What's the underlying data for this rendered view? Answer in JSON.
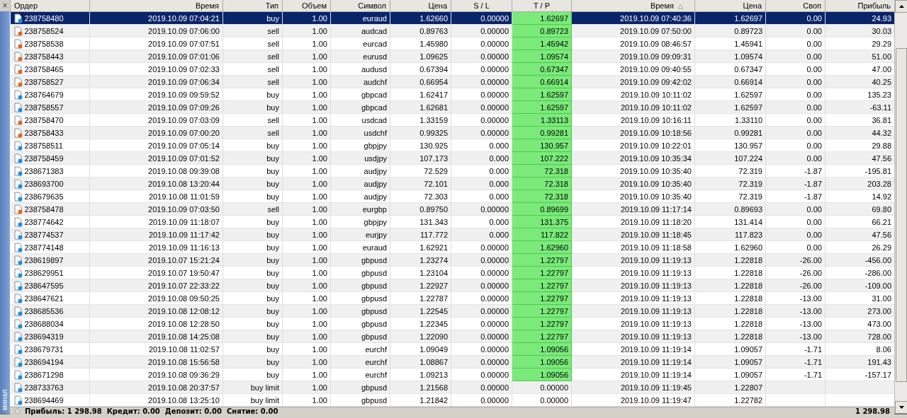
{
  "panel": {
    "close_label": "×",
    "side_label": "минал"
  },
  "table": {
    "columns": [
      {
        "label": "Ордер"
      },
      {
        "label": "Время"
      },
      {
        "label": "Тип"
      },
      {
        "label": "Объем"
      },
      {
        "label": "Символ"
      },
      {
        "label": "Цена"
      },
      {
        "label": "S / L"
      },
      {
        "label": "T / P"
      },
      {
        "label": "Время",
        "sorted": true
      },
      {
        "label": "Цена"
      },
      {
        "label": "Своп"
      },
      {
        "label": "Прибыль"
      }
    ],
    "rows": [
      {
        "kind": "buy",
        "selected": true,
        "tp_hit": true,
        "cells": [
          "238758480",
          "2019.10.09 07:04:21",
          "buy",
          "1.00",
          "euraud",
          "1.62660",
          "0.00000",
          "1.62697",
          "2019.10.09 07:40:36",
          "1.62697",
          "0.00",
          "24.93"
        ]
      },
      {
        "kind": "sell",
        "selected": false,
        "tp_hit": true,
        "cells": [
          "238758524",
          "2019.10.09 07:06:00",
          "sell",
          "1.00",
          "audcad",
          "0.89763",
          "0.00000",
          "0.89723",
          "2019.10.09 07:50:00",
          "0.89723",
          "0.00",
          "30.03"
        ]
      },
      {
        "kind": "sell",
        "selected": false,
        "tp_hit": true,
        "cells": [
          "238758538",
          "2019.10.09 07:07:51",
          "sell",
          "1.00",
          "eurcad",
          "1.45980",
          "0.00000",
          "1.45942",
          "2019.10.09 08:46:57",
          "1.45941",
          "0.00",
          "29.29"
        ]
      },
      {
        "kind": "sell",
        "selected": false,
        "tp_hit": true,
        "cells": [
          "238758443",
          "2019.10.09 07:01:06",
          "sell",
          "1.00",
          "eurusd",
          "1.09625",
          "0.00000",
          "1.09574",
          "2019.10.09 09:09:31",
          "1.09574",
          "0.00",
          "51.00"
        ]
      },
      {
        "kind": "sell",
        "selected": false,
        "tp_hit": true,
        "cells": [
          "238758465",
          "2019.10.09 07:02:33",
          "sell",
          "1.00",
          "audusd",
          "0.67394",
          "0.00000",
          "0.67347",
          "2019.10.09 09:40:55",
          "0.67347",
          "0.00",
          "47.00"
        ]
      },
      {
        "kind": "sell",
        "selected": false,
        "tp_hit": true,
        "cells": [
          "238758527",
          "2019.10.09 07:06:34",
          "sell",
          "1.00",
          "audchf",
          "0.66954",
          "0.00000",
          "0.66914",
          "2019.10.09 09:42:02",
          "0.66914",
          "0.00",
          "40.25"
        ]
      },
      {
        "kind": "buy",
        "selected": false,
        "tp_hit": true,
        "cells": [
          "238764679",
          "2019.10.09 09:59:52",
          "buy",
          "1.00",
          "gbpcad",
          "1.62417",
          "0.00000",
          "1.62597",
          "2019.10.09 10:11:02",
          "1.62597",
          "0.00",
          "135.23"
        ]
      },
      {
        "kind": "buy",
        "selected": false,
        "tp_hit": true,
        "cells": [
          "238758557",
          "2019.10.09 07:09:26",
          "buy",
          "1.00",
          "gbpcad",
          "1.62681",
          "0.00000",
          "1.62597",
          "2019.10.09 10:11:02",
          "1.62597",
          "0.00",
          "-63.11"
        ]
      },
      {
        "kind": "sell",
        "selected": false,
        "tp_hit": true,
        "cells": [
          "238758470",
          "2019.10.09 07:03:09",
          "sell",
          "1.00",
          "usdcad",
          "1.33159",
          "0.00000",
          "1.33113",
          "2019.10.09 10:16:11",
          "1.33110",
          "0.00",
          "36.81"
        ]
      },
      {
        "kind": "sell",
        "selected": false,
        "tp_hit": true,
        "cells": [
          "238758433",
          "2019.10.09 07:00:20",
          "sell",
          "1.00",
          "usdchf",
          "0.99325",
          "0.00000",
          "0.99281",
          "2019.10.09 10:18:56",
          "0.99281",
          "0.00",
          "44.32"
        ]
      },
      {
        "kind": "buy",
        "selected": false,
        "tp_hit": true,
        "cells": [
          "238758511",
          "2019.10.09 07:05:14",
          "buy",
          "1.00",
          "gbpjpy",
          "130.925",
          "0.000",
          "130.957",
          "2019.10.09 10:22:01",
          "130.957",
          "0.00",
          "29.88"
        ]
      },
      {
        "kind": "buy",
        "selected": false,
        "tp_hit": true,
        "cells": [
          "238758459",
          "2019.10.09 07:01:52",
          "buy",
          "1.00",
          "usdjpy",
          "107.173",
          "0.000",
          "107.222",
          "2019.10.09 10:35:34",
          "107.224",
          "0.00",
          "47.56"
        ]
      },
      {
        "kind": "buy",
        "selected": false,
        "tp_hit": true,
        "cells": [
          "238671383",
          "2019.10.08 09:39:08",
          "buy",
          "1.00",
          "audjpy",
          "72.529",
          "0.000",
          "72.318",
          "2019.10.09 10:35:40",
          "72.319",
          "-1.87",
          "-195.81"
        ]
      },
      {
        "kind": "buy",
        "selected": false,
        "tp_hit": true,
        "cells": [
          "238693700",
          "2019.10.08 13:20:44",
          "buy",
          "1.00",
          "audjpy",
          "72.101",
          "0.000",
          "72.318",
          "2019.10.09 10:35:40",
          "72.319",
          "-1.87",
          "203.28"
        ]
      },
      {
        "kind": "buy",
        "selected": false,
        "tp_hit": true,
        "cells": [
          "238679635",
          "2019.10.08 11:01:59",
          "buy",
          "1.00",
          "audjpy",
          "72.303",
          "0.000",
          "72.318",
          "2019.10.09 10:35:40",
          "72.319",
          "-1.87",
          "14.92"
        ]
      },
      {
        "kind": "sell",
        "selected": false,
        "tp_hit": true,
        "cells": [
          "238758478",
          "2019.10.09 07:03:50",
          "sell",
          "1.00",
          "eurgbp",
          "0.89750",
          "0.00000",
          "0.89699",
          "2019.10.09 11:17:14",
          "0.89693",
          "0.00",
          "69.80"
        ]
      },
      {
        "kind": "buy",
        "selected": false,
        "tp_hit": true,
        "cells": [
          "238774642",
          "2019.10.09 11:18:07",
          "buy",
          "1.00",
          "gbpjpy",
          "131.343",
          "0.000",
          "131.375",
          "2019.10.09 11:18:20",
          "131.414",
          "0.00",
          "66.21"
        ]
      },
      {
        "kind": "buy",
        "selected": false,
        "tp_hit": true,
        "cells": [
          "238774537",
          "2019.10.09 11:17:42",
          "buy",
          "1.00",
          "eurjpy",
          "117.772",
          "0.000",
          "117.822",
          "2019.10.09 11:18:45",
          "117.823",
          "0.00",
          "47.56"
        ]
      },
      {
        "kind": "buy",
        "selected": false,
        "tp_hit": true,
        "cells": [
          "238774148",
          "2019.10.09 11:16:13",
          "buy",
          "1.00",
          "euraud",
          "1.62921",
          "0.00000",
          "1.62960",
          "2019.10.09 11:18:58",
          "1.62960",
          "0.00",
          "26.29"
        ]
      },
      {
        "kind": "buy",
        "selected": false,
        "tp_hit": true,
        "cells": [
          "238619897",
          "2019.10.07 15:21:24",
          "buy",
          "1.00",
          "gbpusd",
          "1.23274",
          "0.00000",
          "1.22797",
          "2019.10.09 11:19:13",
          "1.22818",
          "-26.00",
          "-456.00"
        ]
      },
      {
        "kind": "buy",
        "selected": false,
        "tp_hit": true,
        "cells": [
          "238629951",
          "2019.10.07 19:50:47",
          "buy",
          "1.00",
          "gbpusd",
          "1.23104",
          "0.00000",
          "1.22797",
          "2019.10.09 11:19:13",
          "1.22818",
          "-26.00",
          "-286.00"
        ]
      },
      {
        "kind": "buy",
        "selected": false,
        "tp_hit": true,
        "cells": [
          "238647595",
          "2019.10.07 22:33:22",
          "buy",
          "1.00",
          "gbpusd",
          "1.22927",
          "0.00000",
          "1.22797",
          "2019.10.09 11:19:13",
          "1.22818",
          "-26.00",
          "-109.00"
        ]
      },
      {
        "kind": "buy",
        "selected": false,
        "tp_hit": true,
        "cells": [
          "238647621",
          "2019.10.08 09:50:25",
          "buy",
          "1.00",
          "gbpusd",
          "1.22787",
          "0.00000",
          "1.22797",
          "2019.10.09 11:19:13",
          "1.22818",
          "-13.00",
          "31.00"
        ]
      },
      {
        "kind": "buy",
        "selected": false,
        "tp_hit": true,
        "cells": [
          "238685536",
          "2019.10.08 12:08:12",
          "buy",
          "1.00",
          "gbpusd",
          "1.22545",
          "0.00000",
          "1.22797",
          "2019.10.09 11:19:13",
          "1.22818",
          "-13.00",
          "273.00"
        ]
      },
      {
        "kind": "buy",
        "selected": false,
        "tp_hit": true,
        "cells": [
          "238688034",
          "2019.10.08 12:28:50",
          "buy",
          "1.00",
          "gbpusd",
          "1.22345",
          "0.00000",
          "1.22797",
          "2019.10.09 11:19:13",
          "1.22818",
          "-13.00",
          "473.00"
        ]
      },
      {
        "kind": "buy",
        "selected": false,
        "tp_hit": true,
        "cells": [
          "238694319",
          "2019.10.08 14:25:08",
          "buy",
          "1.00",
          "gbpusd",
          "1.22090",
          "0.00000",
          "1.22797",
          "2019.10.09 11:19:13",
          "1.22818",
          "-13.00",
          "728.00"
        ]
      },
      {
        "kind": "buy",
        "selected": false,
        "tp_hit": true,
        "cells": [
          "238679731",
          "2019.10.08 11:02:57",
          "buy",
          "1.00",
          "eurchf",
          "1.09049",
          "0.00000",
          "1.09056",
          "2019.10.09 11:19:14",
          "1.09057",
          "-1.71",
          "8.06"
        ]
      },
      {
        "kind": "buy",
        "selected": false,
        "tp_hit": true,
        "cells": [
          "238694194",
          "2019.10.08 15:56:58",
          "buy",
          "1.00",
          "eurchf",
          "1.08867",
          "0.00000",
          "1.09056",
          "2019.10.09 11:19:14",
          "1.09057",
          "-1.71",
          "191.43"
        ]
      },
      {
        "kind": "buy",
        "selected": false,
        "tp_hit": true,
        "cells": [
          "238671298",
          "2019.10.08 09:36:29",
          "buy",
          "1.00",
          "eurchf",
          "1.09213",
          "0.00000",
          "1.09056",
          "2019.10.09 11:19:14",
          "1.09057",
          "-1.71",
          "-157.17"
        ]
      },
      {
        "kind": "buy",
        "selected": false,
        "tp_hit": false,
        "cells": [
          "238733763",
          "2019.10.08 20:37:57",
          "buy limit",
          "1.00",
          "gbpusd",
          "1.21568",
          "0.00000",
          "0.00000",
          "2019.10.09 11:19:45",
          "1.22807"
        ]
      },
      {
        "kind": "buy",
        "selected": false,
        "tp_hit": false,
        "cells": [
          "238694469",
          "2019.10.08 13:25:10",
          "buy limit",
          "1.00",
          "gbpusd",
          "1.21842",
          "0.00000",
          "0.00000",
          "2019.10.09 11:19:47",
          "1.22782"
        ]
      }
    ]
  },
  "summary": {
    "text": "Прибыль: 1 298.98  Кредит: 0.00  Депозит: 0.00  Снятие: 0.00",
    "total": "1 298.98"
  }
}
